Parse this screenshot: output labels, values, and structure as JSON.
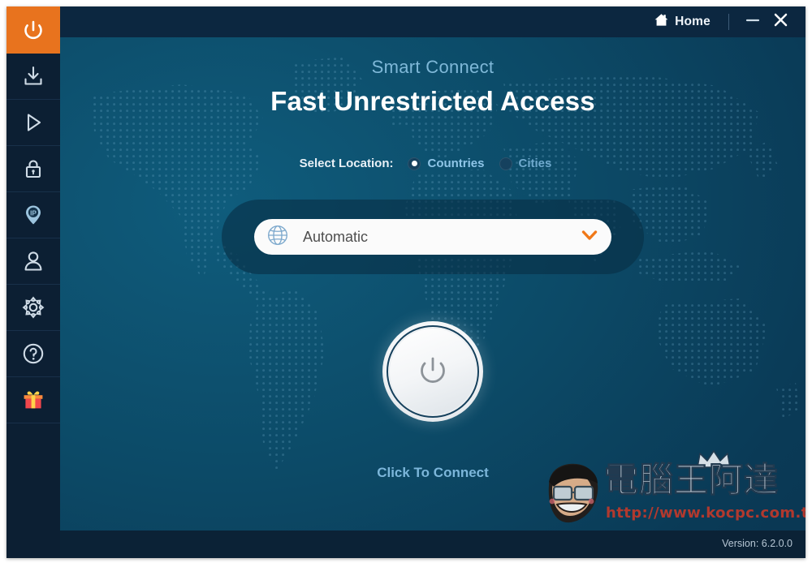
{
  "app": {
    "accent_orange": "#e8731e",
    "bg_teal": "#0b5472",
    "titlebar_bg": "#0c2740",
    "sidebar_bg": "#0c1f33"
  },
  "titlebar": {
    "home_label": "Home",
    "home_icon": "home-icon",
    "minimize_icon": "minimize-icon",
    "close_icon": "close-icon"
  },
  "sidebar": {
    "items": [
      {
        "icon": "power-icon",
        "name": "sidebar-item-power",
        "active": true
      },
      {
        "icon": "download-icon",
        "name": "sidebar-item-download",
        "active": false
      },
      {
        "icon": "play-icon",
        "name": "sidebar-item-play",
        "active": false
      },
      {
        "icon": "lock-icon",
        "name": "sidebar-item-lock",
        "active": false
      },
      {
        "icon": "ip-pin-icon",
        "name": "sidebar-item-ip",
        "active": false
      },
      {
        "icon": "user-icon",
        "name": "sidebar-item-account",
        "active": false
      },
      {
        "icon": "gear-icon",
        "name": "sidebar-item-settings",
        "active": false
      },
      {
        "icon": "help-icon",
        "name": "sidebar-item-help",
        "active": false
      },
      {
        "icon": "gift-icon",
        "name": "sidebar-item-gift",
        "active": false
      }
    ]
  },
  "main": {
    "subtitle": "Smart Connect",
    "headline": "Fast Unrestricted Access",
    "select_location_label": "Select Location:",
    "location_modes": [
      {
        "label": "Countries",
        "selected": true
      },
      {
        "label": "Cities",
        "selected": false
      }
    ],
    "dropdown": {
      "value": "Automatic",
      "globe_icon": "globe-icon",
      "chevron_icon": "chevron-down-icon",
      "chevron_color": "#f07818"
    },
    "power_button": {
      "icon": "power-icon",
      "state_label": "Click To Connect"
    }
  },
  "bottombar": {
    "version": "Version:  6.2.0.0"
  },
  "watermark": {
    "brand_cn": "電腦王阿達",
    "url": "http://www.kocpc.com.tw"
  }
}
